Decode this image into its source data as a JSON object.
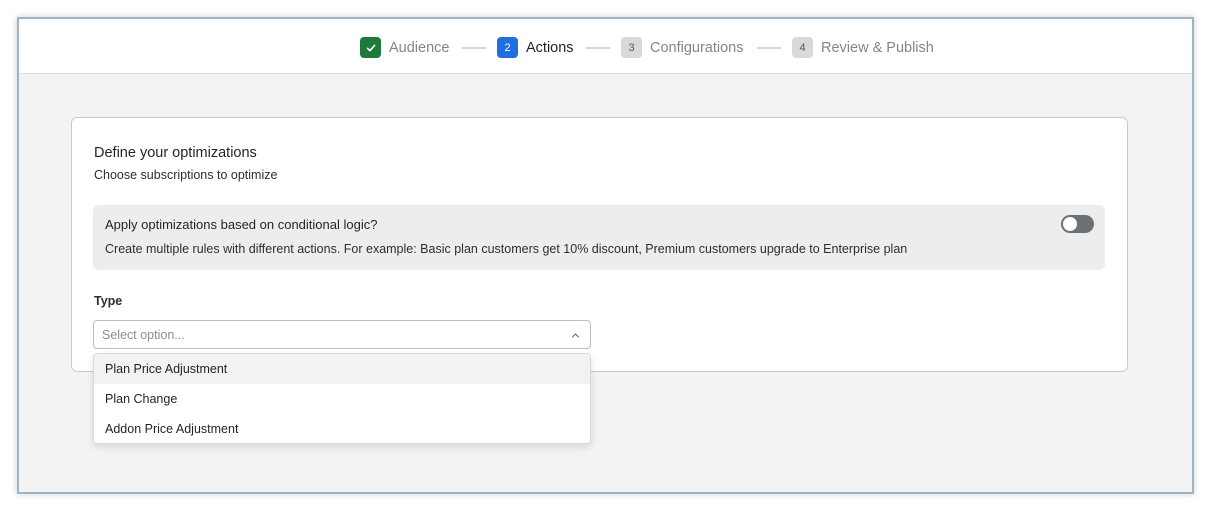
{
  "stepper": {
    "steps": [
      {
        "label": "Audience",
        "badge": "",
        "state": "done",
        "icon": "check-icon"
      },
      {
        "label": "Actions",
        "badge": "2",
        "state": "active"
      },
      {
        "label": "Configurations",
        "badge": "3",
        "state": "pending"
      },
      {
        "label": "Review & Publish",
        "badge": "4",
        "state": "pending"
      }
    ]
  },
  "card": {
    "title": "Define your optimizations",
    "subtitle": "Choose subscriptions to optimize",
    "conditional": {
      "title": "Apply optimizations based on conditional logic?",
      "description": "Create multiple rules with different actions. For example: Basic plan customers get 10% discount, Premium customers upgrade to Enterprise plan",
      "toggle_on": false
    },
    "type": {
      "label": "Type",
      "placeholder": "Select option...",
      "icon": "chevron-up-icon"
    }
  },
  "dropdown": {
    "options": [
      "Plan Price Adjustment",
      "Plan Change",
      "Addon Price Adjustment"
    ],
    "highlighted_index": 0
  },
  "colors": {
    "done": "#1f7a3a",
    "active": "#1f6fe0",
    "pending": "#d9d9dc",
    "toggle_off": "#6b7075",
    "page_bg": "#f3f3f4"
  }
}
